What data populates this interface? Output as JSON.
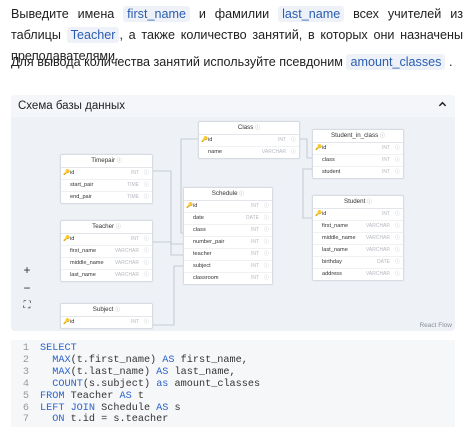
{
  "task": {
    "p1_a": "Выведите имена",
    "p1_code1": "first_name",
    "p1_b": "и фамилии",
    "p1_code2": "last_name",
    "p1_c": "всех учителей из таблицы",
    "p1_code3": "Teacher",
    "p1_d": ", а также количество занятий, в которых они назначены преподавателями.",
    "p2_a": "Для вывода количества занятий используйте псевдоним",
    "p2_code": "amount_classes",
    "p2_b": "."
  },
  "schema": {
    "title": "Схема базы данных",
    "collapse_icon": "chevron-up-icon",
    "attribution": "React Flow",
    "controls": [
      "+",
      "−",
      "⛶"
    ],
    "tables": {
      "class": {
        "name": "Class",
        "rows": [
          {
            "col": "id",
            "type": "INT",
            "pk": true
          },
          {
            "col": "name",
            "type": "VARCHAR"
          }
        ]
      },
      "student_in_class": {
        "name": "Student_in_class",
        "rows": [
          {
            "col": "id",
            "type": "INT",
            "pk": true
          },
          {
            "col": "class",
            "type": "INT"
          },
          {
            "col": "student",
            "type": "INT"
          }
        ]
      },
      "timepair": {
        "name": "Timepair",
        "rows": [
          {
            "col": "id",
            "type": "INT",
            "pk": true
          },
          {
            "col": "start_pair",
            "type": "TIME"
          },
          {
            "col": "end_pair",
            "type": "TIME"
          }
        ]
      },
      "schedule": {
        "name": "Schedule",
        "rows": [
          {
            "col": "id",
            "type": "INT",
            "pk": true
          },
          {
            "col": "date",
            "type": "DATE"
          },
          {
            "col": "class",
            "type": "INT"
          },
          {
            "col": "number_pair",
            "type": "INT"
          },
          {
            "col": "teacher",
            "type": "INT"
          },
          {
            "col": "subject",
            "type": "INT"
          },
          {
            "col": "classroom",
            "type": "INT"
          }
        ]
      },
      "student": {
        "name": "Student",
        "rows": [
          {
            "col": "id",
            "type": "INT",
            "pk": true
          },
          {
            "col": "first_name",
            "type": "VARCHAR"
          },
          {
            "col": "middle_name",
            "type": "VARCHAR"
          },
          {
            "col": "last_name",
            "type": "VARCHAR"
          },
          {
            "col": "birthday",
            "type": "DATE"
          },
          {
            "col": "address",
            "type": "VARCHAR"
          }
        ]
      },
      "teacher": {
        "name": "Teacher",
        "rows": [
          {
            "col": "id",
            "type": "INT",
            "pk": true
          },
          {
            "col": "first_name",
            "type": "VARCHAR"
          },
          {
            "col": "middle_name",
            "type": "VARCHAR"
          },
          {
            "col": "last_name",
            "type": "VARCHAR"
          }
        ]
      },
      "subject": {
        "name": "Subject",
        "rows": [
          {
            "col": "id",
            "type": "INT",
            "pk": true
          }
        ]
      }
    }
  },
  "code": {
    "line_numbers": [
      "1",
      "2",
      "3",
      "4",
      "5",
      "6",
      "7"
    ],
    "lines": [
      [
        {
          "t": "SELECT",
          "k": true
        }
      ],
      [
        {
          "t": "  ",
          "k": false
        },
        {
          "t": "MAX",
          "k": true
        },
        {
          "t": "(t.first_name) ",
          "k": false
        },
        {
          "t": "AS",
          "k": true
        },
        {
          "t": " first_name,",
          "k": false
        }
      ],
      [
        {
          "t": "  ",
          "k": false
        },
        {
          "t": "MAX",
          "k": true
        },
        {
          "t": "(t.last_name) ",
          "k": false
        },
        {
          "t": "AS",
          "k": true
        },
        {
          "t": " last_name,",
          "k": false
        }
      ],
      [
        {
          "t": "  ",
          "k": false
        },
        {
          "t": "COUNT",
          "k": true
        },
        {
          "t": "(s.subject) ",
          "k": false
        },
        {
          "t": "as",
          "k": true
        },
        {
          "t": " amount_classes",
          "k": false
        }
      ],
      [
        {
          "t": "FROM",
          "k": true
        },
        {
          "t": " Teacher ",
          "k": false
        },
        {
          "t": "AS",
          "k": true
        },
        {
          "t": " t",
          "k": false
        }
      ],
      [
        {
          "t": "LEFT JOIN",
          "k": true
        },
        {
          "t": " Schedule ",
          "k": false
        },
        {
          "t": "AS",
          "k": true
        },
        {
          "t": " s",
          "k": false
        }
      ],
      [
        {
          "t": "  ",
          "k": false
        },
        {
          "t": "ON",
          "k": true
        },
        {
          "t": " t.id = s.teacher",
          "k": false
        }
      ]
    ]
  }
}
